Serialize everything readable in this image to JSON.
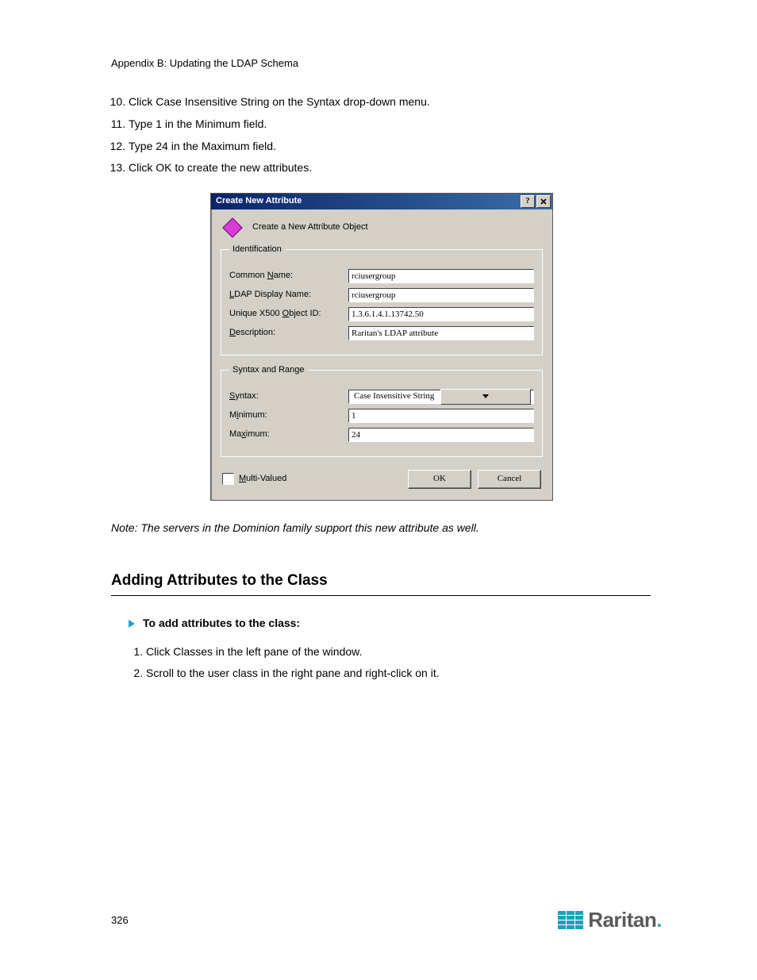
{
  "chapter_head": "Appendix B: Updating the LDAP Schema",
  "intro_steps": [
    "Click Case Insensitive String on the Syntax drop-down menu.",
    "Type 1 in the Minimum field.",
    "Type 24 in the Maximum field.",
    "Click OK to create the new attributes."
  ],
  "intro_steps_start": 10,
  "dialog": {
    "title": "Create New Attribute",
    "header_text": "Create a New Attribute Object",
    "groups": {
      "identification": {
        "legend": "Identification",
        "common_name_label": "Common Name:",
        "common_name_value": "rciusergroup",
        "ldap_display_label": "LDAP Display Name:",
        "ldap_display_value": "rciusergroup",
        "oid_label": "Unique X500 Object ID:",
        "oid_value": "1.3.6.1.4.1.13742.50",
        "description_label": "Description:",
        "description_value": "Raritan's LDAP attribute"
      },
      "syntax": {
        "legend": "Syntax and Range",
        "syntax_label": "Syntax:",
        "syntax_value": "Case Insensitive String",
        "min_label": "Minimum:",
        "min_value": "1",
        "max_label": "Maximum:",
        "max_value": "24"
      }
    },
    "multi_valued_label": "Multi-Valued",
    "ok_label": "OK",
    "cancel_label": "Cancel"
  },
  "note_text": "Note: The servers in the Dominion family support this new attribute as well.",
  "section_title": "Adding Attributes to the Class",
  "subhead_text": "To add attributes to the class:",
  "class_steps": [
    "Click Classes in the left pane of the window.",
    "Scroll to the user class in the right pane and right-click on it."
  ],
  "logo_text": "Raritan",
  "page_number": "326"
}
